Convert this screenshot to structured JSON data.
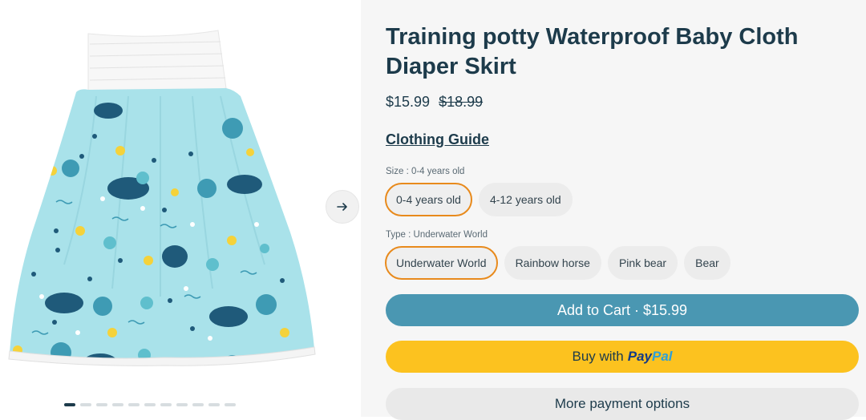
{
  "product": {
    "title": "Training potty Waterproof Baby Cloth Diaper Skirt",
    "price": "$15.99",
    "compare_price": "$18.99",
    "clothing_guide": "Clothing Guide"
  },
  "options": {
    "size": {
      "label": "Size : 0-4 years old",
      "values": [
        "0-4 years old",
        "4-12 years old"
      ],
      "selected": "0-4 years old"
    },
    "type": {
      "label": "Type : Underwater World",
      "values": [
        "Underwater World",
        "Rainbow horse",
        "Pink bear",
        "Bear"
      ],
      "selected": "Underwater World"
    }
  },
  "buttons": {
    "add_to_cart": "Add to Cart · $15.99",
    "buy_with": "Buy with",
    "paypal_pay": "Pay",
    "paypal_pal": "Pal",
    "more_payment": "More payment options"
  },
  "gallery": {
    "image_count": 11,
    "active_index": 0,
    "next_icon": "arrow-right-icon"
  },
  "colors": {
    "primary_text": "#1d3b4b",
    "cart_button": "#4a97b2",
    "paypal_button": "#fcc21f",
    "selected_border": "#e88a1c",
    "skirt_fabric": "#a9e2ea"
  }
}
